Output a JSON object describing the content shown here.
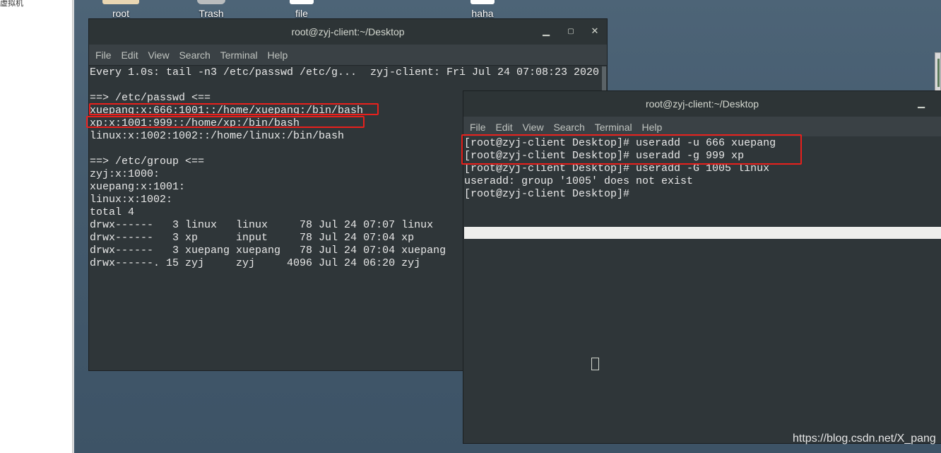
{
  "host": {
    "strip_text": "虚拟机"
  },
  "desktop": {
    "icons": [
      {
        "label": "root",
        "icon": "folder-icon"
      },
      {
        "label": "Trash",
        "icon": "trash-icon"
      },
      {
        "label": "file",
        "icon": "file-icon"
      },
      {
        "label": "haha",
        "icon": "file-icon"
      }
    ]
  },
  "terminal_back": {
    "title": "root@zyj-client:~/Desktop",
    "menu": [
      "File",
      "Edit",
      "View",
      "Search",
      "Terminal",
      "Help"
    ],
    "header_left": "Every 1.0s: tail -n3 /etc/passwd /etc/g...",
    "header_right": "zyj-client: Fri Jul 24 07:08:23 2020",
    "lines": [
      "",
      "==> /etc/passwd <==",
      "xuepang:x:666:1001::/home/xuepang:/bin/bash",
      "xp:x:1001:999::/home/xp:/bin/bash",
      "linux:x:1002:1002::/home/linux:/bin/bash",
      "",
      "==> /etc/group <==",
      "zyj:x:1000:",
      "xuepang:x:1001:",
      "linux:x:1002:",
      "total 4",
      "drwx------   3 linux   linux     78 Jul 24 07:07 linux",
      "drwx------   3 xp      input     78 Jul 24 07:04 xp",
      "drwx------   3 xuepang xuepang   78 Jul 24 07:04 xuepang",
      "drwx------. 15 zyj     zyj     4096 Jul 24 06:20 zyj"
    ]
  },
  "terminal_front": {
    "title": "root@zyj-client:~/Desktop",
    "menu": [
      "File",
      "Edit",
      "View",
      "Search",
      "Terminal",
      "Help"
    ],
    "lines": [
      "[root@zyj-client Desktop]# useradd -u 666 xuepang",
      "[root@zyj-client Desktop]# useradd -g 999 xp",
      "[root@zyj-client Desktop]# useradd -G 1005 linux",
      "useradd: group '1005' does not exist",
      "[root@zyj-client Desktop]#"
    ]
  },
  "watermark": "https://blog.csdn.net/X_pang",
  "colors": {
    "highlight": "#e8201c",
    "terminal_bg": "#2f3639",
    "desktop_bg": "#445a6d"
  }
}
